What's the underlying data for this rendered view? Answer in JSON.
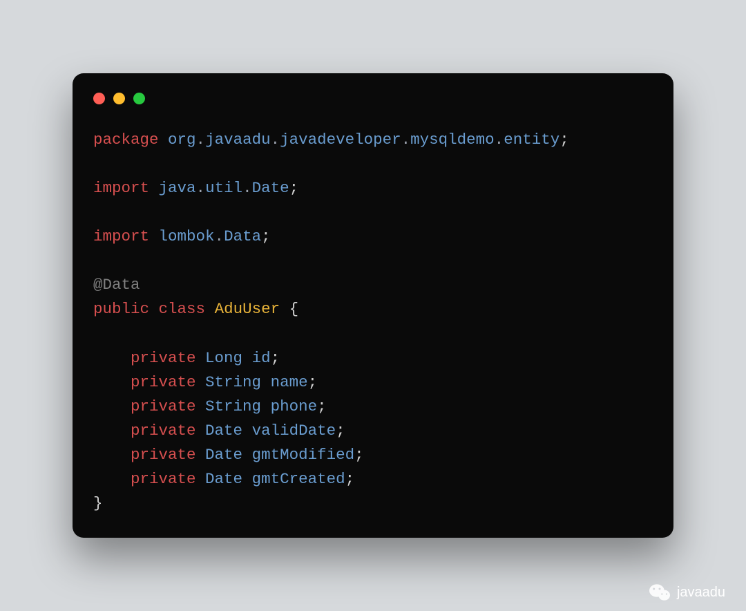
{
  "window": {
    "dots": [
      "red",
      "yellow",
      "green"
    ]
  },
  "code": {
    "lines": [
      {
        "indent": 0,
        "tokens": [
          {
            "t": "package",
            "c": "kw"
          },
          {
            "t": " ",
            "c": "punct"
          },
          {
            "t": "org",
            "c": "ns"
          },
          {
            "t": ".",
            "c": "pkg"
          },
          {
            "t": "javaadu",
            "c": "ns"
          },
          {
            "t": ".",
            "c": "pkg"
          },
          {
            "t": "javadeveloper",
            "c": "ns"
          },
          {
            "t": ".",
            "c": "pkg"
          },
          {
            "t": "mysqldemo",
            "c": "ns"
          },
          {
            "t": ".",
            "c": "pkg"
          },
          {
            "t": "entity",
            "c": "ns"
          },
          {
            "t": ";",
            "c": "punct"
          }
        ]
      },
      {
        "indent": 0,
        "tokens": []
      },
      {
        "indent": 0,
        "tokens": [
          {
            "t": "import",
            "c": "kw"
          },
          {
            "t": " ",
            "c": "punct"
          },
          {
            "t": "java",
            "c": "ns"
          },
          {
            "t": ".",
            "c": "pkg"
          },
          {
            "t": "util",
            "c": "ns"
          },
          {
            "t": ".",
            "c": "pkg"
          },
          {
            "t": "Date",
            "c": "ns"
          },
          {
            "t": ";",
            "c": "punct"
          }
        ]
      },
      {
        "indent": 0,
        "tokens": []
      },
      {
        "indent": 0,
        "tokens": [
          {
            "t": "import",
            "c": "kw"
          },
          {
            "t": " ",
            "c": "punct"
          },
          {
            "t": "lombok",
            "c": "ns"
          },
          {
            "t": ".",
            "c": "pkg"
          },
          {
            "t": "Data",
            "c": "ns"
          },
          {
            "t": ";",
            "c": "punct"
          }
        ]
      },
      {
        "indent": 0,
        "tokens": []
      },
      {
        "indent": 0,
        "tokens": [
          {
            "t": "@Data",
            "c": "anno"
          }
        ]
      },
      {
        "indent": 0,
        "tokens": [
          {
            "t": "public",
            "c": "kw"
          },
          {
            "t": " ",
            "c": "punct"
          },
          {
            "t": "class",
            "c": "kw"
          },
          {
            "t": " ",
            "c": "punct"
          },
          {
            "t": "AduUser",
            "c": "cls"
          },
          {
            "t": " {",
            "c": "punct"
          }
        ]
      },
      {
        "indent": 0,
        "tokens": []
      },
      {
        "indent": 1,
        "tokens": [
          {
            "t": "private",
            "c": "kw"
          },
          {
            "t": " ",
            "c": "punct"
          },
          {
            "t": "Long",
            "c": "ns"
          },
          {
            "t": " ",
            "c": "punct"
          },
          {
            "t": "id",
            "c": "ns"
          },
          {
            "t": ";",
            "c": "punct"
          }
        ]
      },
      {
        "indent": 1,
        "tokens": [
          {
            "t": "private",
            "c": "kw"
          },
          {
            "t": " ",
            "c": "punct"
          },
          {
            "t": "String",
            "c": "ns"
          },
          {
            "t": " ",
            "c": "punct"
          },
          {
            "t": "name",
            "c": "ns"
          },
          {
            "t": ";",
            "c": "punct"
          }
        ]
      },
      {
        "indent": 1,
        "tokens": [
          {
            "t": "private",
            "c": "kw"
          },
          {
            "t": " ",
            "c": "punct"
          },
          {
            "t": "String",
            "c": "ns"
          },
          {
            "t": " ",
            "c": "punct"
          },
          {
            "t": "phone",
            "c": "ns"
          },
          {
            "t": ";",
            "c": "punct"
          }
        ]
      },
      {
        "indent": 1,
        "tokens": [
          {
            "t": "private",
            "c": "kw"
          },
          {
            "t": " ",
            "c": "punct"
          },
          {
            "t": "Date",
            "c": "ns"
          },
          {
            "t": " ",
            "c": "punct"
          },
          {
            "t": "validDate",
            "c": "ns"
          },
          {
            "t": ";",
            "c": "punct"
          }
        ]
      },
      {
        "indent": 1,
        "tokens": [
          {
            "t": "private",
            "c": "kw"
          },
          {
            "t": " ",
            "c": "punct"
          },
          {
            "t": "Date",
            "c": "ns"
          },
          {
            "t": " ",
            "c": "punct"
          },
          {
            "t": "gmtModified",
            "c": "ns"
          },
          {
            "t": ";",
            "c": "punct"
          }
        ]
      },
      {
        "indent": 1,
        "tokens": [
          {
            "t": "private",
            "c": "kw"
          },
          {
            "t": " ",
            "c": "punct"
          },
          {
            "t": "Date",
            "c": "ns"
          },
          {
            "t": " ",
            "c": "punct"
          },
          {
            "t": "gmtCreated",
            "c": "ns"
          },
          {
            "t": ";",
            "c": "punct"
          }
        ]
      },
      {
        "indent": 0,
        "tokens": [
          {
            "t": "}",
            "c": "punct"
          }
        ]
      }
    ]
  },
  "watermark": {
    "text": "javaadu",
    "icon": "wechat-icon"
  }
}
